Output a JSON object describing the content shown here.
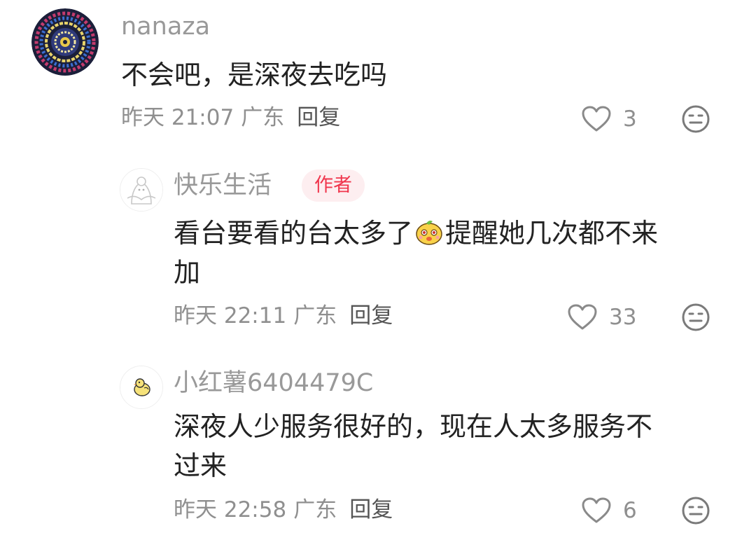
{
  "comments": [
    {
      "username": "nanaza",
      "text": "不会吧，是深夜去吃吗",
      "date": "昨天 21:07",
      "location": "广东",
      "reply_label": "回复",
      "like_count": "3"
    },
    {
      "username": "快乐生活",
      "badge": "作者",
      "text_part1": "看台要看的台太多了",
      "text_part2": "提醒她几次都不来",
      "text_part3": "加",
      "emoji_name": "cute-face-emoji",
      "date": "昨天 22:11",
      "location": "广东",
      "reply_label": "回复",
      "like_count": "33"
    },
    {
      "username": "小红薯6404479C",
      "text_line1": "深夜人少服务很好的，现在人太多服务不",
      "text_line2": "过来",
      "date": "昨天 22:58",
      "location": "广东",
      "reply_label": "回复",
      "like_count": "6"
    }
  ],
  "icons": {
    "like": "heart-outline-icon",
    "dislike": "meh-face-icon"
  },
  "colors": {
    "badge_text": "#f0364d",
    "badge_bg": "#fdeef0",
    "meta": "#8f8f8f"
  }
}
